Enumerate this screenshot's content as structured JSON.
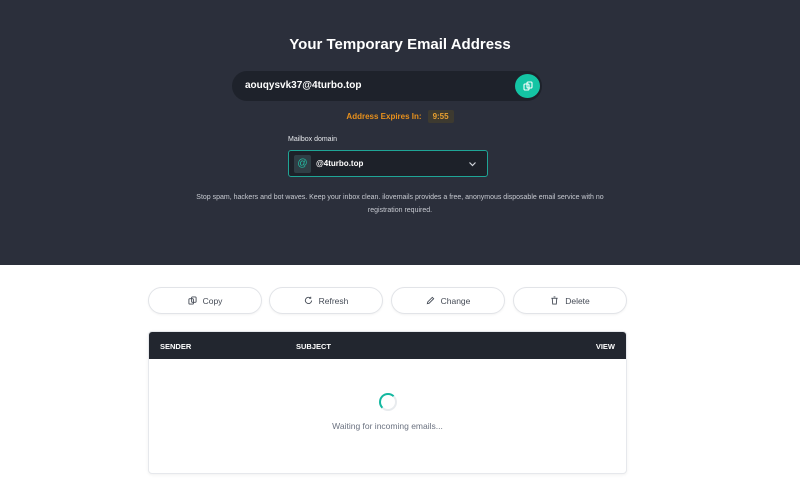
{
  "hero": {
    "title": "Your Temporary Email Address",
    "email": "aouqysvk37@4turbo.top",
    "expires_label": "Address Expires In:",
    "expires_timer": "9:55",
    "domain_label": "Mailbox domain",
    "domain_value": "@4turbo.top",
    "tagline": "Stop spam, hackers and bot waves. Keep your inbox clean. ilovemails provides a free, anonymous disposable email service with no registration required."
  },
  "actions": {
    "copy": "Copy",
    "refresh": "Refresh",
    "change": "Change",
    "delete": "Delete"
  },
  "inbox": {
    "columns": {
      "sender": "SENDER",
      "subject": "SUBJECT",
      "view": "VIEW"
    },
    "empty_text": "Waiting for incoming emails..."
  },
  "colors": {
    "hero_bg": "#2b2f3b",
    "accent": "#14c4a4",
    "expires": "#e8901c",
    "table_header": "#22262f"
  }
}
